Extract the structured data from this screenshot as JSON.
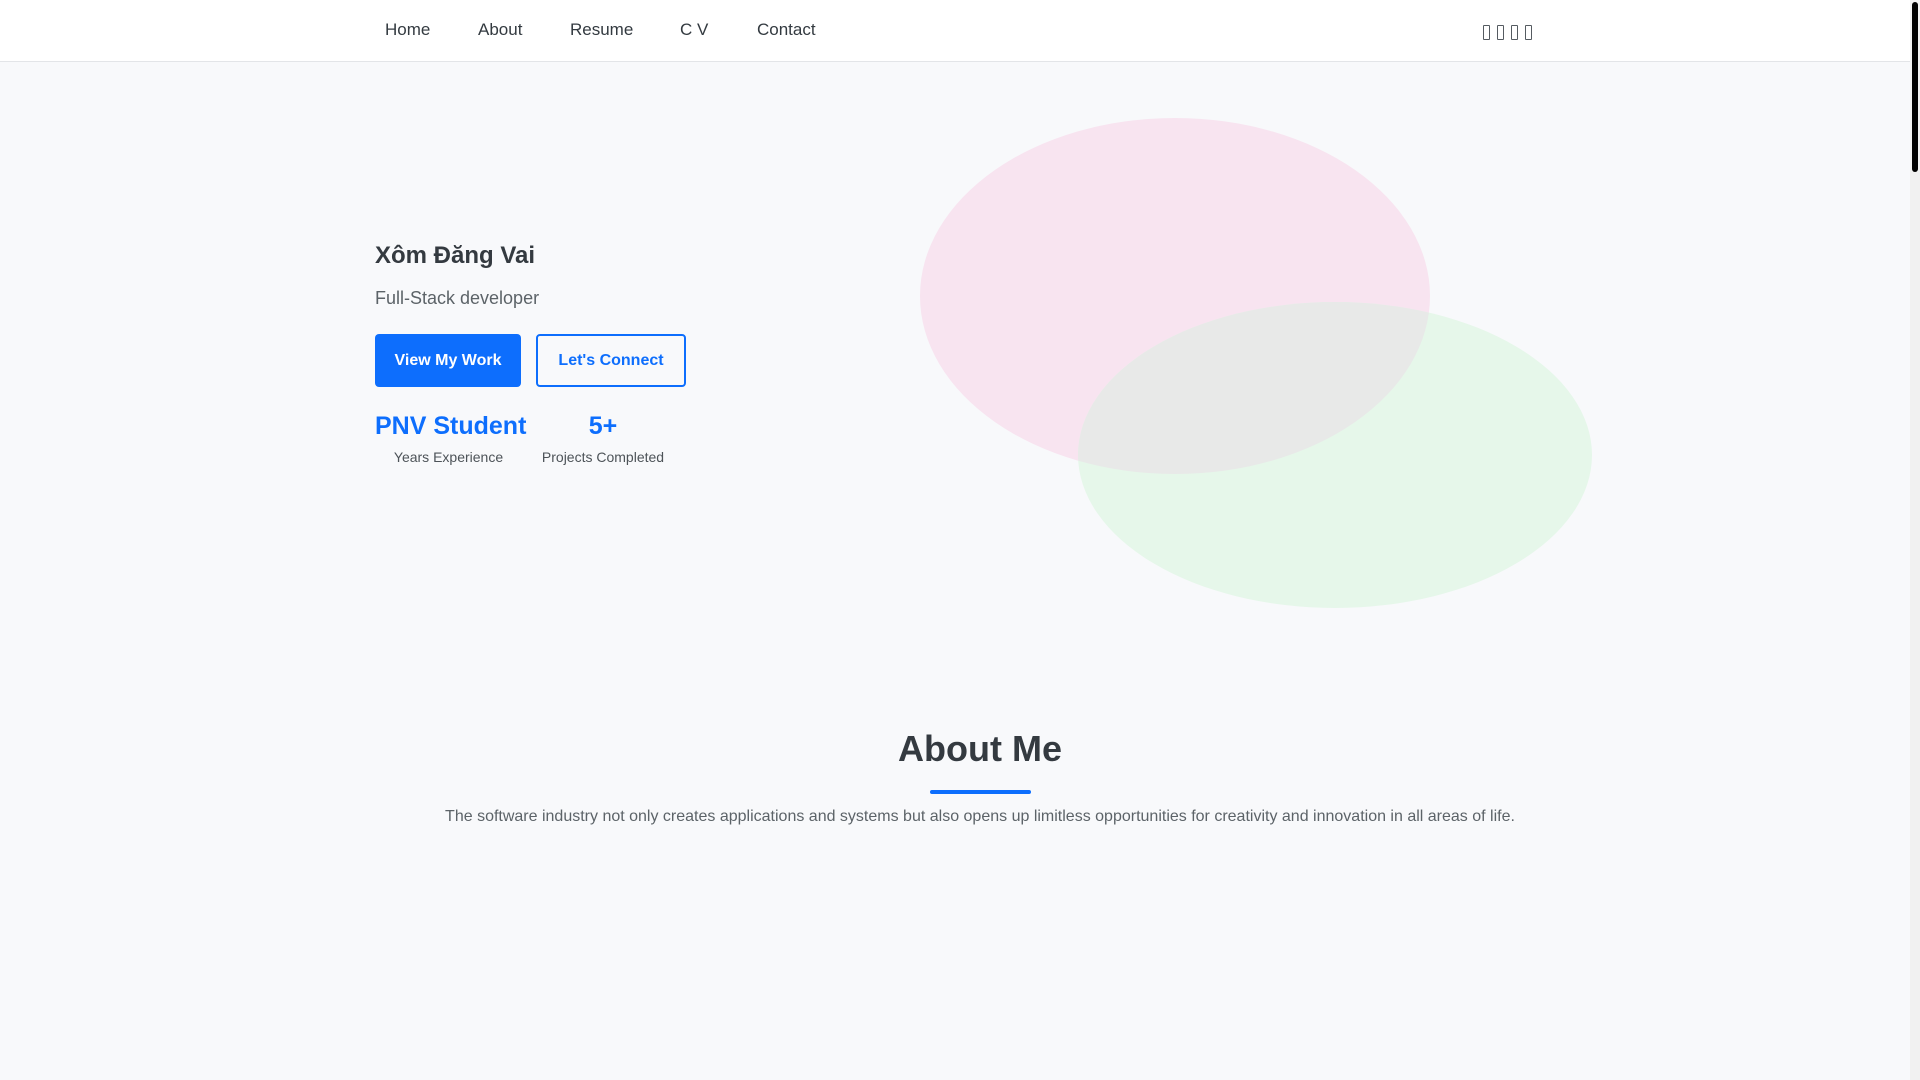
{
  "nav": {
    "items": [
      {
        "label": "Home"
      },
      {
        "label": "About"
      },
      {
        "label": "Resume"
      },
      {
        "label": "C V"
      },
      {
        "label": "Contact"
      }
    ],
    "social_icons": [
      "social-icon-1",
      "social-icon-2",
      "social-icon-3",
      "social-icon-4"
    ]
  },
  "hero": {
    "name": "Xôm Đăng Vai",
    "role": "Full-Stack developer",
    "primary_button": "View My Work",
    "secondary_button": "Let's Connect",
    "stats": [
      {
        "value": "PNV Student",
        "label": "Years Experience"
      },
      {
        "value": "5+",
        "label": "Projects Completed"
      }
    ]
  },
  "about": {
    "title": "About Me",
    "text": "The software industry not only creates applications and systems but also opens up limitless opportunities for creativity and innovation in all areas of life."
  },
  "colors": {
    "accent": "#0d6efd",
    "blob_pink": "#f8e4f0",
    "blob_green": "#e6f7ea",
    "blob_overlap": "#e8e9e8"
  }
}
